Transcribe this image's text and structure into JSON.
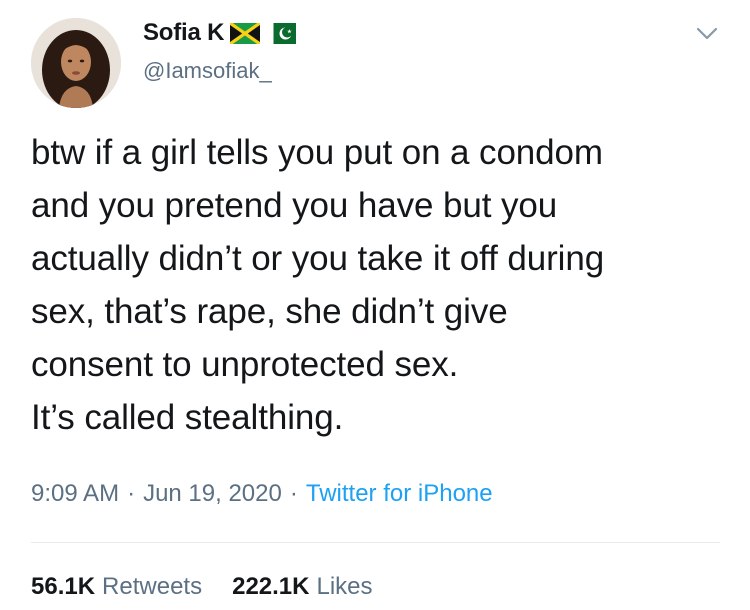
{
  "tweet": {
    "author": {
      "display_name": "Sofia K",
      "handle": "@Iamsofiak_",
      "flags": [
        "jamaica-flag-icon",
        "pakistan-flag-icon"
      ]
    },
    "body_lines": [
      "btw if a girl tells you put on a condom",
      "and you pretend you have but you",
      "actually didn’t or you take it off during",
      "sex, that’s rape, she didn’t give",
      "consent to unprotected sex.",
      "It’s called stealthing."
    ],
    "meta": {
      "time": "9:09 AM",
      "separator": "·",
      "date": "Jun 19, 2020",
      "source": "Twitter for iPhone"
    },
    "stats": {
      "retweets_count": "56.1K",
      "retweets_label": "Retweets",
      "likes_count": "222.1K",
      "likes_label": "Likes"
    }
  },
  "colors": {
    "text": "#14171a",
    "secondary": "#5b7083",
    "link": "#1da1f2",
    "divider": "#e6ecf0"
  }
}
